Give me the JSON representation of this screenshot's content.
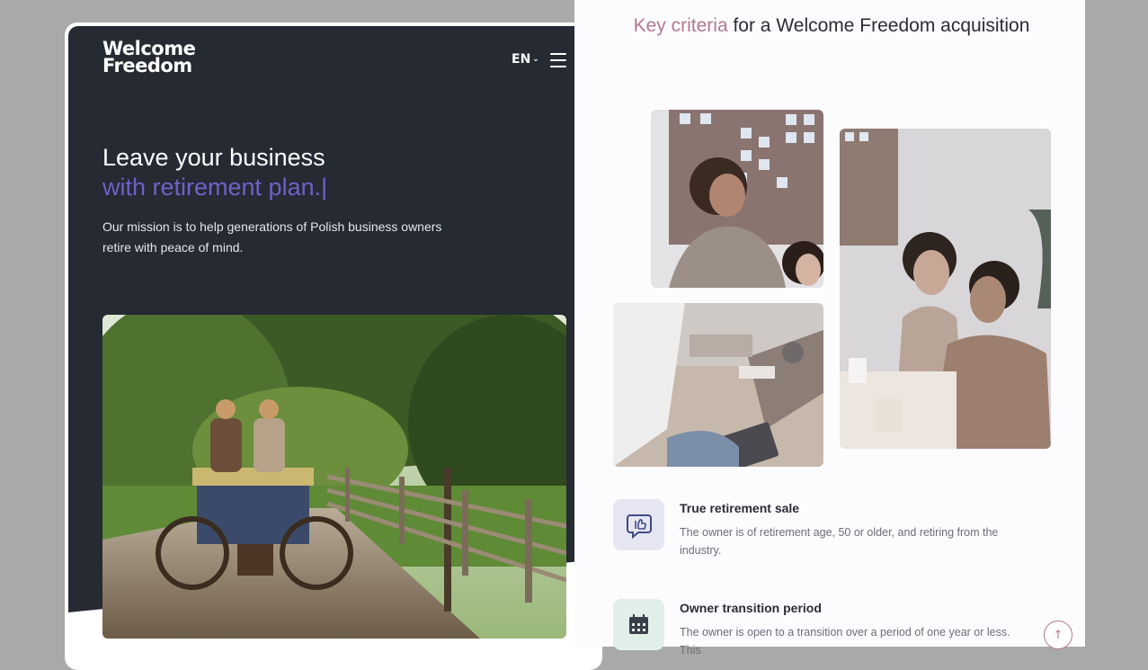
{
  "left": {
    "logo": {
      "line1": "Welcome",
      "line2": "Freedom"
    },
    "lang": "EN",
    "hero": {
      "title_line1": "Leave your business",
      "title_line2": "with retirement plan.",
      "caret": "|",
      "subtitle": "Our mission is to help generations of Polish business owners retire with peace of mind."
    }
  },
  "right": {
    "heading": {
      "accent": "Key criteria",
      "rest": "for a Welcome Freedom acquisition"
    },
    "features": [
      {
        "title": "True retirement sale",
        "desc": "The owner is of retirement age, 50 or older, and retiring from the industry."
      },
      {
        "title": "Owner transition period",
        "desc": "The owner is open to a transition over a period of one year or less. This"
      }
    ],
    "scroll_top": "↑"
  },
  "colors": {
    "dark": "#252a33",
    "accent_purple": "#6b63c9",
    "accent_rose": "#b07a8c"
  },
  "icons": [
    "menu-icon",
    "chevron-down-icon",
    "thumbs-up-chat-icon",
    "calendar-icon",
    "arrow-up-icon"
  ]
}
